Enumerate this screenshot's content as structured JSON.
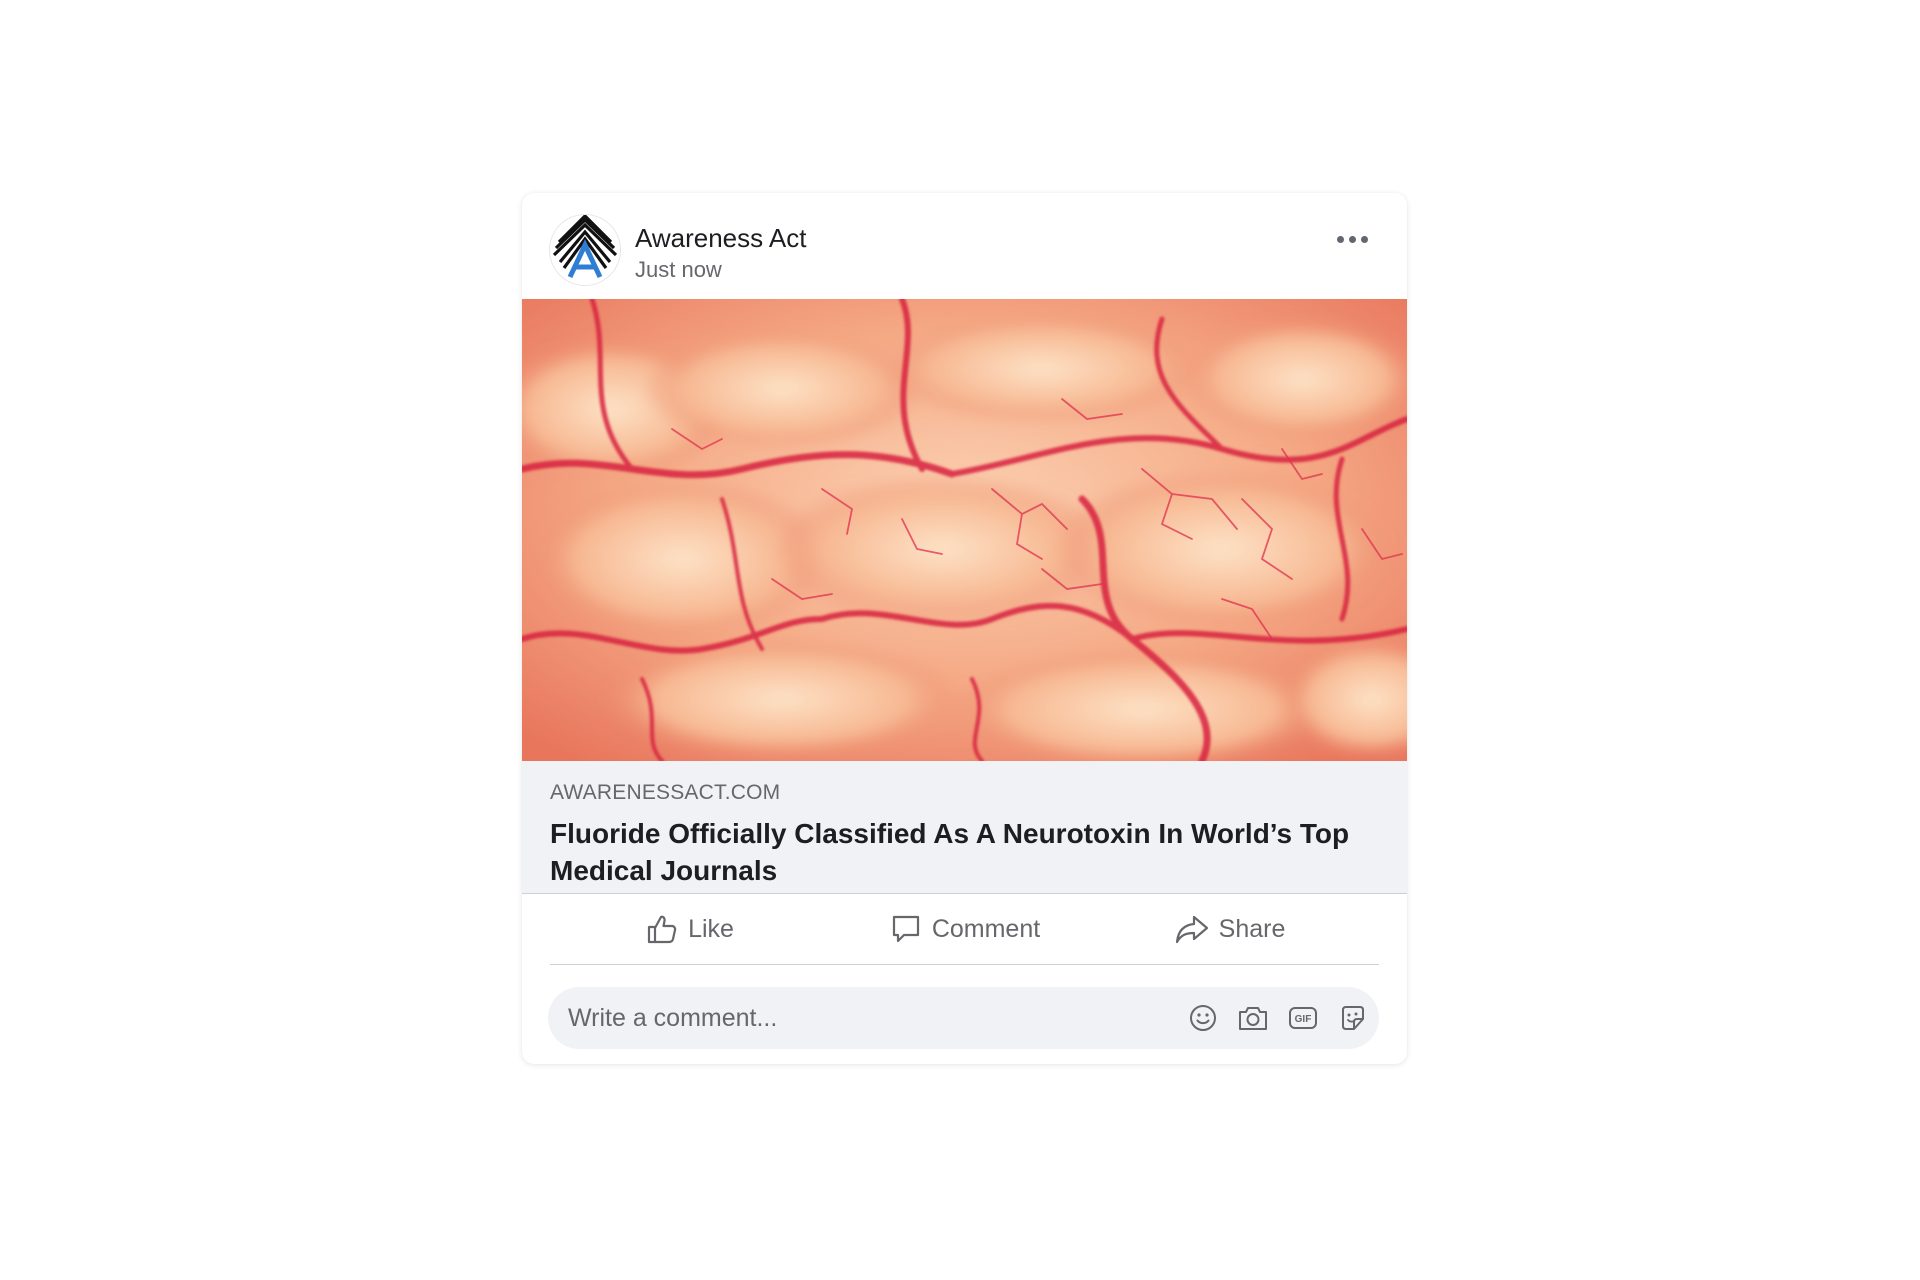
{
  "post": {
    "author": "Awareness Act",
    "timestamp": "Just now",
    "menu_icon": "more-horizontal-icon",
    "image_description_icon": "brain-tissue-photo"
  },
  "link": {
    "domain": "AWARENESSACT.COM",
    "title": "Fluoride Officially Classified As A Neurotoxin In World’s Top Medical Journals"
  },
  "actions": {
    "like": "Like",
    "comment": "Comment",
    "share": "Share"
  },
  "comment_box": {
    "placeholder": "Write a comment...",
    "tools": [
      "emoji-icon",
      "camera-icon",
      "gif-icon",
      "sticker-icon"
    ]
  },
  "colors": {
    "text_primary": "#1c1e21",
    "text_secondary": "#65676b",
    "panel_bg": "#f0f2f5",
    "logo_blue": "#2e7fd3"
  }
}
